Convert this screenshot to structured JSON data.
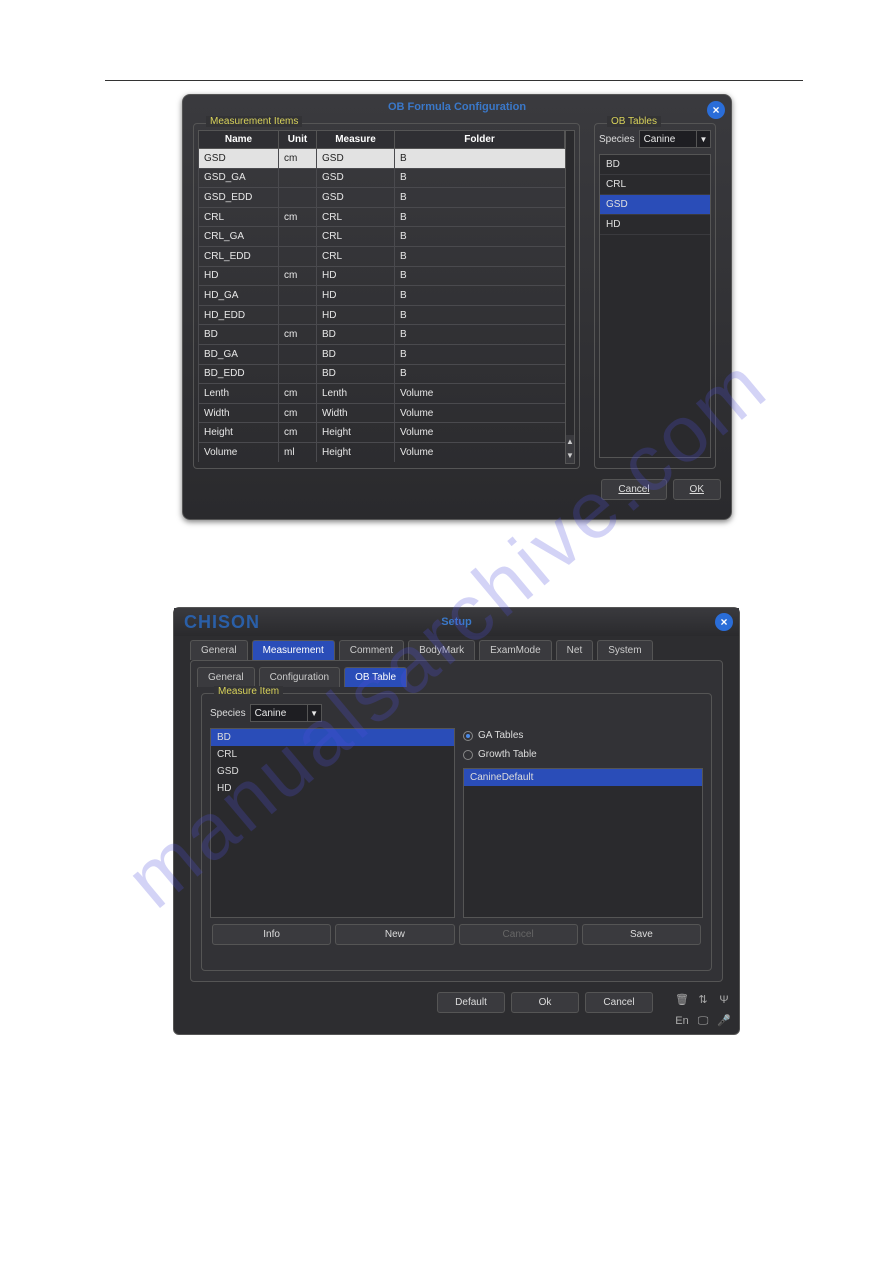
{
  "watermark": "manualsarchive.com",
  "dialog1": {
    "title": "OB Formula Configuration",
    "close_icon": "×",
    "measurement_legend": "Measurement Items",
    "ob_tables_legend": "OB Tables",
    "columns": {
      "name": "Name",
      "unit": "Unit",
      "measure": "Measure",
      "folder": "Folder"
    },
    "rows": [
      {
        "name": "GSD",
        "unit": "cm",
        "measure": "GSD",
        "folder": "B",
        "selected": true
      },
      {
        "name": "GSD_GA",
        "unit": "",
        "measure": "GSD",
        "folder": "B"
      },
      {
        "name": "GSD_EDD",
        "unit": "",
        "measure": "GSD",
        "folder": "B"
      },
      {
        "name": "CRL",
        "unit": "cm",
        "measure": "CRL",
        "folder": "B"
      },
      {
        "name": "CRL_GA",
        "unit": "",
        "measure": "CRL",
        "folder": "B"
      },
      {
        "name": "CRL_EDD",
        "unit": "",
        "measure": "CRL",
        "folder": "B"
      },
      {
        "name": "HD",
        "unit": "cm",
        "measure": "HD",
        "folder": "B"
      },
      {
        "name": "HD_GA",
        "unit": "",
        "measure": "HD",
        "folder": "B"
      },
      {
        "name": "HD_EDD",
        "unit": "",
        "measure": "HD",
        "folder": "B"
      },
      {
        "name": "BD",
        "unit": "cm",
        "measure": "BD",
        "folder": "B"
      },
      {
        "name": "BD_GA",
        "unit": "",
        "measure": "BD",
        "folder": "B"
      },
      {
        "name": "BD_EDD",
        "unit": "",
        "measure": "BD",
        "folder": "B"
      },
      {
        "name": "Lenth",
        "unit": "cm",
        "measure": "Lenth",
        "folder": "Volume"
      },
      {
        "name": "Width",
        "unit": "cm",
        "measure": "Width",
        "folder": "Volume"
      },
      {
        "name": "Height",
        "unit": "cm",
        "measure": "Height",
        "folder": "Volume"
      },
      {
        "name": "Volume",
        "unit": "ml",
        "measure": "Height",
        "folder": "Volume"
      }
    ],
    "species_label": "Species",
    "species_value": "Canine",
    "ob_items": [
      {
        "label": "BD"
      },
      {
        "label": "CRL"
      },
      {
        "label": "GSD",
        "selected": true
      },
      {
        "label": "HD"
      }
    ],
    "cancel": "Cancel",
    "ok": "OK"
  },
  "dialog2": {
    "brand": "CHISON",
    "title": "Setup",
    "close_icon": "×",
    "tabs": [
      "General",
      "Measurement",
      "Comment",
      "BodyMark",
      "ExamMode",
      "Net",
      "System"
    ],
    "active_tab": 1,
    "subtabs": [
      "General",
      "Configuration",
      "OB Table"
    ],
    "active_subtab": 2,
    "measure_item_legend": "Measure Item",
    "species_label": "Species",
    "species_value": "Canine",
    "measure_items": [
      {
        "label": "BD",
        "selected": true
      },
      {
        "label": "CRL"
      },
      {
        "label": "GSD"
      },
      {
        "label": "HD"
      }
    ],
    "radio_ga": "GA Tables",
    "radio_growth": "Growth Table",
    "radio_selected": "ga",
    "tables": [
      {
        "label": "CanineDefault",
        "selected": true
      }
    ],
    "actions": {
      "info": "Info",
      "new": "New",
      "cancel": "Cancel",
      "save": "Save"
    },
    "footer": {
      "default": "Default",
      "ok": "Ok",
      "cancel": "Cancel"
    },
    "status_icons": [
      "trash-icon",
      "network-icon",
      "usb-icon",
      "language-icon",
      "display-icon",
      "mic-icon"
    ],
    "status_glyphs": {
      "trash-icon": "🗑",
      "network-icon": "⇅",
      "usb-icon": "Ψ",
      "language-icon": "En",
      "display-icon": "🖵",
      "mic-icon": "🎤"
    }
  }
}
